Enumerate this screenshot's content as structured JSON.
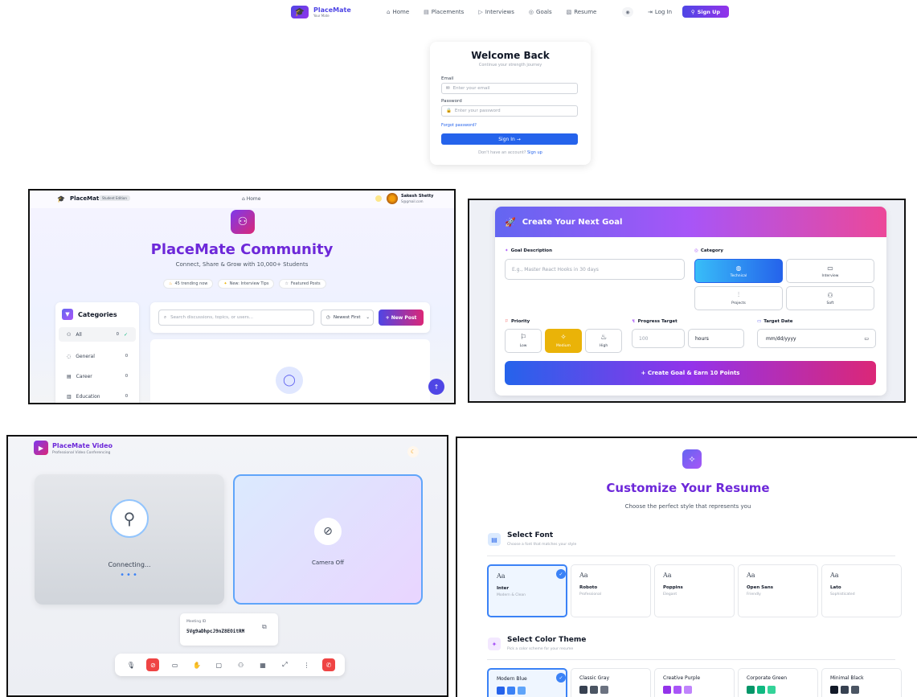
{
  "nav": {
    "brand": "PlaceMate",
    "brand_sub": "Your Mate",
    "links": [
      {
        "icon": "⌂",
        "label": "Home"
      },
      {
        "icon": "▤",
        "label": "Placements"
      },
      {
        "icon": "▷",
        "label": "Interviews"
      },
      {
        "icon": "◎",
        "label": "Goals"
      },
      {
        "icon": "▧",
        "label": "Resume"
      }
    ],
    "login_label": "Log In",
    "signup_label": "Sign Up"
  },
  "login": {
    "title": "Welcome Back",
    "subtitle": "Continue your strength journey",
    "email_label": "Email",
    "email_placeholder": "Enter your email",
    "password_label": "Password",
    "password_placeholder": "Enter your password",
    "forgot": "Forgot password?",
    "signin": "Sign In →",
    "no_account": "Don't have an account?",
    "signup_link": "Sign up"
  },
  "community": {
    "brand": "PlaceMate",
    "badge": "Student Edition",
    "home": "Home",
    "user_name": "Sakesh Shetty",
    "user_email": "S@gmail.com",
    "title": "PlaceMate Community",
    "subtitle": "Connect, Share & Grow with 10,000+ Students",
    "chips": [
      "45 trending now",
      "New: Interview Tips",
      "Featured Posts"
    ],
    "categories_title": "Categories",
    "categories": [
      {
        "label": "All",
        "count": "0"
      },
      {
        "label": "General",
        "count": "0"
      },
      {
        "label": "Career",
        "count": "0"
      },
      {
        "label": "Education",
        "count": "0"
      }
    ],
    "search_placeholder": "Search discussions, topics, or users...",
    "sort": "Newest First",
    "new_post": "+ New Post"
  },
  "goal": {
    "header": "Create Your Next Goal",
    "desc_label": "Goal Description",
    "desc_placeholder": "E.g., Master React Hooks in 30 days",
    "category_label": "Category",
    "categories": [
      "Technical",
      "Interview",
      "Projects",
      "Soft"
    ],
    "priority_label": "Priority",
    "priorities": [
      "Low",
      "Medium",
      "High"
    ],
    "progress_label": "Progress Target",
    "progress_value": "100",
    "progress_unit": "hours",
    "date_label": "Target Date",
    "date_placeholder": "mm/dd/yyyy",
    "submit": "+ Create Goal & Earn 10 Points"
  },
  "video": {
    "title": "PlaceMate Video",
    "subtitle": "Professional Video Conferencing",
    "connecting": "Connecting...",
    "camera_off": "Camera Off",
    "meeting_label": "Meeting ID",
    "meeting_id": "5Vg9aDhpcJ9nZ8EOitRM"
  },
  "resume": {
    "title": "Customize Your Resume",
    "subtitle": "Choose the perfect style that represents you",
    "font_section": "Select Font",
    "font_section_sub": "Choose a font that matches your style",
    "fonts": [
      {
        "aa": "Aa",
        "name": "Inter",
        "desc": "Modern & Clean"
      },
      {
        "aa": "Aa",
        "name": "Roboto",
        "desc": "Professional"
      },
      {
        "aa": "Aa",
        "name": "Poppins",
        "desc": "Elegant"
      },
      {
        "aa": "Aa",
        "name": "Open Sans",
        "desc": "Friendly"
      },
      {
        "aa": "Aa",
        "name": "Lato",
        "desc": "Sophisticated"
      }
    ],
    "theme_section": "Select Color Theme",
    "theme_section_sub": "Pick a color scheme for your resume",
    "themes": [
      {
        "name": "Modern Blue",
        "colors": [
          "#2563eb",
          "#3b82f6",
          "#60a5fa"
        ]
      },
      {
        "name": "Classic Gray",
        "colors": [
          "#374151",
          "#4b5563",
          "#6b7280"
        ]
      },
      {
        "name": "Creative Purple",
        "colors": [
          "#9333ea",
          "#a855f7",
          "#c084fc"
        ]
      },
      {
        "name": "Corporate Green",
        "colors": [
          "#059669",
          "#10b981",
          "#34d399"
        ]
      },
      {
        "name": "Minimal Black",
        "colors": [
          "#111827",
          "#374151",
          "#4b5563"
        ]
      }
    ]
  },
  "colors": {
    "primary_blue": "#2563eb",
    "purple": "#7c3aed",
    "pink": "#db2777",
    "medium_yellow": "#eab308",
    "danger_red": "#ef4444"
  }
}
